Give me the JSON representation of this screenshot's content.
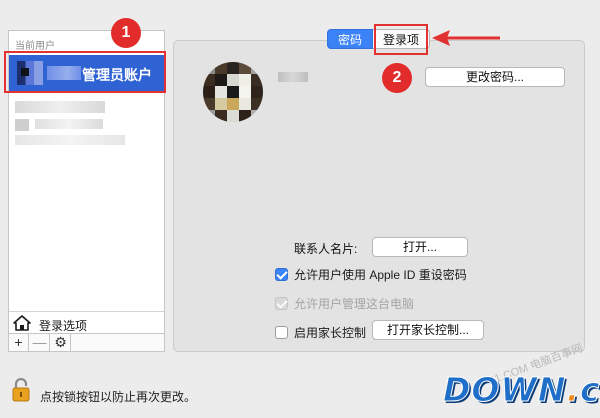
{
  "sidebar": {
    "heading": "当前用户",
    "selected_user_label": "管理员账户",
    "login_options_label": "登录选项",
    "toolbar": {
      "add": "+",
      "remove": "—",
      "gear": "⚙"
    }
  },
  "tabs": [
    {
      "label": "密码",
      "active": true
    },
    {
      "label": "登录项",
      "active": false
    }
  ],
  "annotations": {
    "badge_1": "1",
    "badge_2": "2",
    "highlight_color": "#e23131"
  },
  "buttons": {
    "change_password": "更改密码...",
    "open_contact_card": "打开...",
    "open_parental_controls": "打开家长控制..."
  },
  "labels": {
    "contact_card": "联系人名片:"
  },
  "checkboxes": [
    {
      "label": "允许用户使用 Apple ID 重设密码",
      "checked": true,
      "disabled": false
    },
    {
      "label": "允许用户管理这台电脑",
      "checked": true,
      "disabled": true
    },
    {
      "label": "启用家长控制",
      "checked": false,
      "disabled": false
    }
  ],
  "footer": {
    "lock_text": "点按锁按钮以防止再次更改。"
  },
  "watermark": {
    "small_text": "41.COM 电脑百事网",
    "logo_main": "DOWN",
    "logo_dot": ".",
    "logo_tld": "cc"
  },
  "colors": {
    "accent": "#3b82f6",
    "selection": "#2f63d3",
    "badge": "#e22b2b"
  }
}
